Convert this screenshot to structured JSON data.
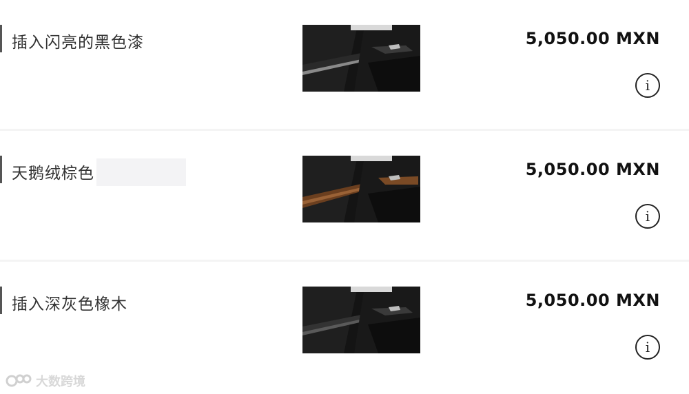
{
  "items": [
    {
      "label": "插入闪亮的黑色漆",
      "price": "5,050.00 MXN",
      "info_icon": "info-icon",
      "trim": "gloss-black"
    },
    {
      "label": "天鹅绒棕色",
      "price": "5,050.00 MXN",
      "info_icon": "info-icon",
      "trim": "brown-wood"
    },
    {
      "label": "插入深灰色橡木",
      "price": "5,050.00 MXN",
      "info_icon": "info-icon",
      "trim": "grey-oak"
    }
  ],
  "info_glyph": "i",
  "watermark": {
    "text": "大数跨境"
  },
  "colors": {
    "background": "#f4f4f4",
    "row": "#ffffff",
    "text": "#333333",
    "price": "#111111"
  }
}
